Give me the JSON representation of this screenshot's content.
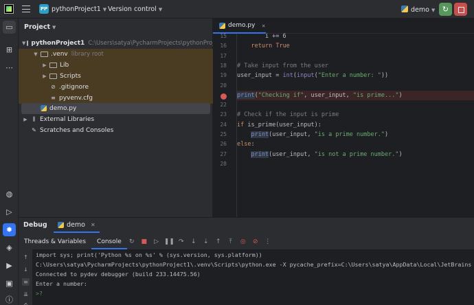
{
  "titlebar": {
    "project_badge": "PP",
    "project_name": "pythonProject1",
    "version_control": "Version control",
    "run_config": "demo"
  },
  "project_pane": {
    "title": "Project",
    "tree": [
      {
        "label": "pythonProject1",
        "hint": "C:\\Users\\satya\\PycharmProjects\\pythonProject1"
      },
      {
        "label": ".venv",
        "hint": "library root"
      },
      {
        "label": "Lib"
      },
      {
        "label": "Scripts"
      },
      {
        "label": ".gitignore"
      },
      {
        "label": "pyvenv.cfg"
      },
      {
        "label": "demo.py"
      },
      {
        "label": "External Libraries"
      },
      {
        "label": "Scratches and Consoles"
      }
    ]
  },
  "editor": {
    "tab": "demo.py",
    "line_numbers": [
      "15",
      "16",
      "17",
      "18",
      "19",
      "20",
      "21",
      "22",
      "23",
      "24",
      "25",
      "26",
      "27",
      "28"
    ],
    "lines": {
      "l15a": "        i += 6",
      "l16a": "    ",
      "l16b": "return",
      "l16c": " ",
      "l16d": "True",
      "l18": "# Take input from the user",
      "l19a": "user_input = ",
      "l19b": "int",
      "l19c": "(",
      "l19d": "input",
      "l19e": "(",
      "l19f": "\"Enter a number: \"",
      "l19g": "))",
      "l21a": "print",
      "l21b": "(",
      "l21c": "\"Checking if\"",
      "l21d": ", user_input, ",
      "l21e": "\"is prime...\"",
      "l21f": ")",
      "l23": "# Check if the input is prime",
      "l24a": "if",
      "l24b": " is_prime(user_input):",
      "l25a": "    ",
      "l25b": "print",
      "l25c": "(user_input, ",
      "l25d": "\"is a prime number.\"",
      "l25e": ")",
      "l26a": "else",
      "l26b": ":",
      "l27a": "    ",
      "l27b": "print",
      "l27c": "(user_input, ",
      "l27d": "\"is not a prime number.\"",
      "l27e": ")"
    }
  },
  "debug": {
    "title": "Debug",
    "session_tab": "demo",
    "subtabs": [
      "Threads & Variables",
      "Console"
    ],
    "console_lines": [
      "import sys; print('Python %s on %s' % (sys.version, sys.platform))",
      "C:\\Users\\satya\\PycharmProjects\\pythonProject1\\.venv\\Scripts\\python.exe -X pycache_prefix=C:\\Users\\satya\\AppData\\Local\\JetBrains",
      "Connected to pydev debugger (build 233.14475.56)",
      "Enter a number:",
      ">?"
    ]
  },
  "colors": {
    "accent": "#3574f0",
    "breakpoint": "#d65a5a",
    "venv_highlight": "#4a3c23"
  }
}
